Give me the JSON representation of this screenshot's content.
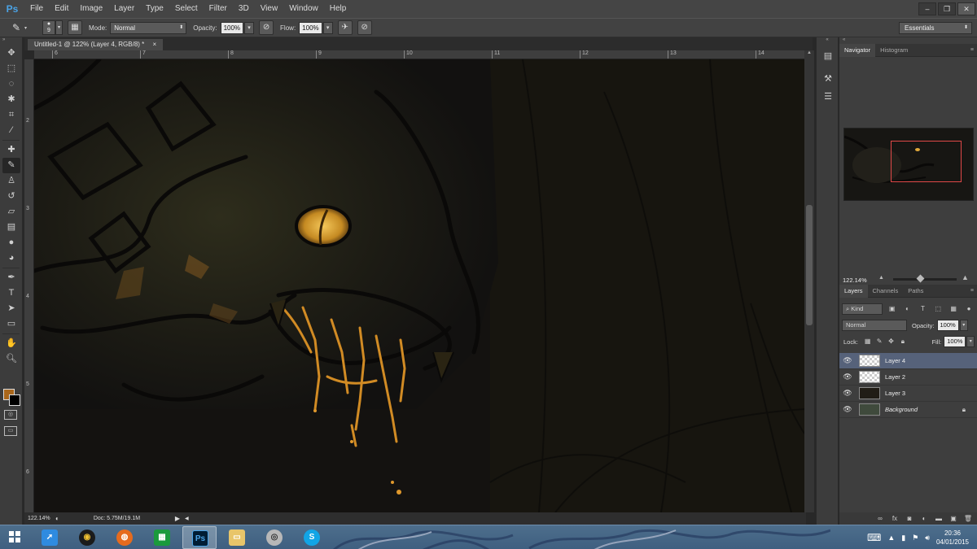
{
  "app": {
    "logo": "Ps",
    "menu": [
      "File",
      "Edit",
      "Image",
      "Layer",
      "Type",
      "Select",
      "Filter",
      "3D",
      "View",
      "Window",
      "Help"
    ],
    "window_controls": [
      "–",
      "❐",
      "✕"
    ]
  },
  "options": {
    "brush_size": "9",
    "mode_label": "Mode:",
    "mode_value": "Normal",
    "opacity_label": "Opacity:",
    "opacity_value": "100%",
    "flow_label": "Flow:",
    "flow_value": "100%",
    "workspace": "Essentials"
  },
  "document": {
    "tab_title": "Untitled-1 @ 122% (Layer 4, RGB/8) *",
    "tab_close": "×",
    "ruler_top": [
      "6",
      "7",
      "8",
      "9",
      "10",
      "11",
      "12",
      "13",
      "14"
    ],
    "ruler_left": [
      "2",
      "3",
      "4",
      "5",
      "6"
    ]
  },
  "status": {
    "zoom": "122.14%",
    "doc_info": "Doc: 5.75M/19.1M"
  },
  "colors": {
    "foreground": "#a9671c",
    "background": "#000000",
    "canvas": "#141210",
    "eye_glow": "#e0a83a",
    "nav_box": "#e04848"
  },
  "navigator": {
    "tabs": [
      "Navigator",
      "Histogram"
    ],
    "zoom": "122.14%"
  },
  "layers_panel": {
    "tabs": [
      "Layers",
      "Channels",
      "Paths"
    ],
    "kind": "Kind",
    "blend_mode": "Normal",
    "opacity_label": "Opacity:",
    "opacity_value": "100%",
    "lock_label": "Lock:",
    "fill_label": "Fill:",
    "fill_value": "100%",
    "layers": [
      {
        "name": "Layer 4",
        "active": true
      },
      {
        "name": "Layer 2",
        "active": false
      },
      {
        "name": "Layer 3",
        "active": false
      },
      {
        "name": "Background",
        "active": false
      }
    ]
  },
  "taskbar": {
    "apps": [
      "start",
      "rocket",
      "media-player",
      "firefox",
      "store",
      "photoshop",
      "file-explorer",
      "audio-player",
      "skype"
    ],
    "time": "20:36",
    "date": "04/01/2015"
  }
}
